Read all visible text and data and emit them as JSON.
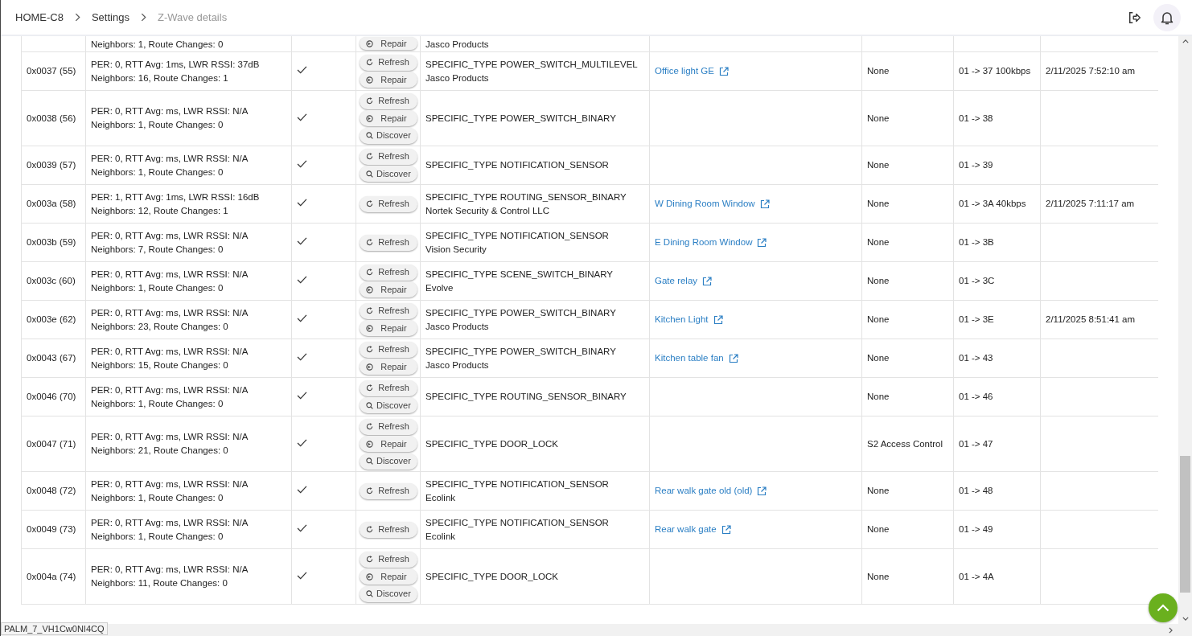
{
  "breadcrumb": [
    {
      "label": "HOME-C8",
      "current": false
    },
    {
      "label": "Settings",
      "current": false
    },
    {
      "label": "Z-Wave details",
      "current": true
    }
  ],
  "partial_row": {
    "stats_2": "Neighbors: 1, Route Changes: 0",
    "buttons": [
      {
        "kind": "repair",
        "label": "Repair"
      }
    ],
    "manufacturer": "Jasco Products"
  },
  "rows": [
    {
      "node": "0x0037 (55)",
      "stats_1": "PER: 0, RTT Avg: 1ms, LWR RSSI: 37dB",
      "stats_2": "Neighbors: 16, Route Changes: 1",
      "checked": true,
      "buttons": [
        {
          "kind": "refresh",
          "label": "Refresh"
        },
        {
          "kind": "repair",
          "label": "Repair"
        }
      ],
      "type": "SPECIFIC_TYPE POWER_SWITCH_MULTILEVEL",
      "manufacturer": "Jasco Products",
      "device": "Office light GE",
      "security": "None",
      "route": "01 -> 37 100kbps",
      "last_activity": "2/11/2025 7:52:10 am"
    },
    {
      "node": "0x0038 (56)",
      "stats_1": "PER: 0, RTT Avg: ms, LWR RSSI: N/A",
      "stats_2": "Neighbors: 1, Route Changes: 0",
      "checked": true,
      "buttons": [
        {
          "kind": "refresh",
          "label": "Refresh"
        },
        {
          "kind": "repair",
          "label": "Repair"
        },
        {
          "kind": "discover",
          "label": "Discover"
        }
      ],
      "type": "SPECIFIC_TYPE POWER_SWITCH_BINARY",
      "security": "None",
      "route": "01 -> 38"
    },
    {
      "node": "0x0039 (57)",
      "stats_1": "PER: 0, RTT Avg: ms, LWR RSSI: N/A",
      "stats_2": "Neighbors: 1, Route Changes: 0",
      "checked": true,
      "buttons": [
        {
          "kind": "refresh",
          "label": "Refresh"
        },
        {
          "kind": "discover",
          "label": "Discover"
        }
      ],
      "type": "SPECIFIC_TYPE NOTIFICATION_SENSOR",
      "security": "None",
      "route": "01 -> 39"
    },
    {
      "node": "0x003a (58)",
      "stats_1": "PER: 1, RTT Avg: 1ms, LWR RSSI: 16dB",
      "stats_2": "Neighbors: 12, Route Changes: 1",
      "checked": true,
      "buttons": [
        {
          "kind": "refresh",
          "label": "Refresh"
        }
      ],
      "type": "SPECIFIC_TYPE ROUTING_SENSOR_BINARY",
      "manufacturer": "Nortek Security & Control LLC",
      "device": "W Dining Room Window",
      "security": "None",
      "route": "01 -> 3A 40kbps",
      "last_activity": "2/11/2025 7:11:17 am"
    },
    {
      "node": "0x003b (59)",
      "stats_1": "PER: 0, RTT Avg: ms, LWR RSSI: N/A",
      "stats_2": "Neighbors: 7, Route Changes: 0",
      "checked": true,
      "buttons": [
        {
          "kind": "refresh",
          "label": "Refresh"
        }
      ],
      "type": "SPECIFIC_TYPE NOTIFICATION_SENSOR",
      "manufacturer": "Vision Security",
      "device": "E Dining Room Window",
      "security": "None",
      "route": "01 -> 3B"
    },
    {
      "node": "0x003c (60)",
      "stats_1": "PER: 0, RTT Avg: ms, LWR RSSI: N/A",
      "stats_2": "Neighbors: 1, Route Changes: 0",
      "checked": true,
      "buttons": [
        {
          "kind": "refresh",
          "label": "Refresh"
        },
        {
          "kind": "repair",
          "label": "Repair"
        }
      ],
      "type": "SPECIFIC_TYPE SCENE_SWITCH_BINARY",
      "manufacturer": "Evolve",
      "device": "Gate relay",
      "security": "None",
      "route": "01 -> 3C"
    },
    {
      "node": "0x003e (62)",
      "stats_1": "PER: 0, RTT Avg: ms, LWR RSSI: N/A",
      "stats_2": "Neighbors: 23, Route Changes: 0",
      "checked": true,
      "buttons": [
        {
          "kind": "refresh",
          "label": "Refresh"
        },
        {
          "kind": "repair",
          "label": "Repair"
        }
      ],
      "type": "SPECIFIC_TYPE POWER_SWITCH_BINARY",
      "manufacturer": "Jasco Products",
      "device": "Kitchen Light",
      "security": "None",
      "route": "01 -> 3E",
      "last_activity": "2/11/2025 8:51:41 am"
    },
    {
      "node": "0x0043 (67)",
      "stats_1": "PER: 0, RTT Avg: ms, LWR RSSI: N/A",
      "stats_2": "Neighbors: 15, Route Changes: 0",
      "checked": true,
      "buttons": [
        {
          "kind": "refresh",
          "label": "Refresh"
        },
        {
          "kind": "repair",
          "label": "Repair"
        }
      ],
      "type": "SPECIFIC_TYPE POWER_SWITCH_BINARY",
      "manufacturer": "Jasco Products",
      "device": "Kitchen table fan",
      "security": "None",
      "route": "01 -> 43"
    },
    {
      "node": "0x0046 (70)",
      "stats_1": "PER: 0, RTT Avg: ms, LWR RSSI: N/A",
      "stats_2": "Neighbors: 1, Route Changes: 0",
      "checked": true,
      "buttons": [
        {
          "kind": "refresh",
          "label": "Refresh"
        },
        {
          "kind": "discover",
          "label": "Discover"
        }
      ],
      "type": "SPECIFIC_TYPE ROUTING_SENSOR_BINARY",
      "security": "None",
      "route": "01 -> 46"
    },
    {
      "node": "0x0047 (71)",
      "stats_1": "PER: 0, RTT Avg: ms, LWR RSSI: N/A",
      "stats_2": "Neighbors: 21, Route Changes: 0",
      "checked": true,
      "buttons": [
        {
          "kind": "refresh",
          "label": "Refresh"
        },
        {
          "kind": "repair",
          "label": "Repair"
        },
        {
          "kind": "discover",
          "label": "Discover"
        }
      ],
      "type": "SPECIFIC_TYPE DOOR_LOCK",
      "security": "S2 Access Control",
      "route": "01 -> 47"
    },
    {
      "node": "0x0048 (72)",
      "stats_1": "PER: 0, RTT Avg: ms, LWR RSSI: N/A",
      "stats_2": "Neighbors: 1, Route Changes: 0",
      "checked": true,
      "buttons": [
        {
          "kind": "refresh",
          "label": "Refresh"
        }
      ],
      "type": "SPECIFIC_TYPE NOTIFICATION_SENSOR",
      "manufacturer": "Ecolink",
      "device": "Rear walk gate old (old)",
      "security": "None",
      "route": "01 -> 48"
    },
    {
      "node": "0x0049 (73)",
      "stats_1": "PER: 0, RTT Avg: ms, LWR RSSI: N/A",
      "stats_2": "Neighbors: 1, Route Changes: 0",
      "checked": true,
      "buttons": [
        {
          "kind": "refresh",
          "label": "Refresh"
        }
      ],
      "type": "SPECIFIC_TYPE NOTIFICATION_SENSOR",
      "manufacturer": "Ecolink",
      "device": "Rear walk gate",
      "security": "None",
      "route": "01 -> 49"
    },
    {
      "node": "0x004a (74)",
      "stats_1": "PER: 0, RTT Avg: ms, LWR RSSI: N/A",
      "stats_2": "Neighbors: 11, Route Changes: 0",
      "checked": true,
      "buttons": [
        {
          "kind": "refresh",
          "label": "Refresh"
        },
        {
          "kind": "repair",
          "label": "Repair"
        },
        {
          "kind": "discover",
          "label": "Discover"
        }
      ],
      "type": "SPECIFIC_TYPE DOOR_LOCK",
      "security": "None",
      "route": "01 -> 4A"
    }
  ],
  "status_tooltip": "PALM_7_VH1Cw0NI4CQ"
}
